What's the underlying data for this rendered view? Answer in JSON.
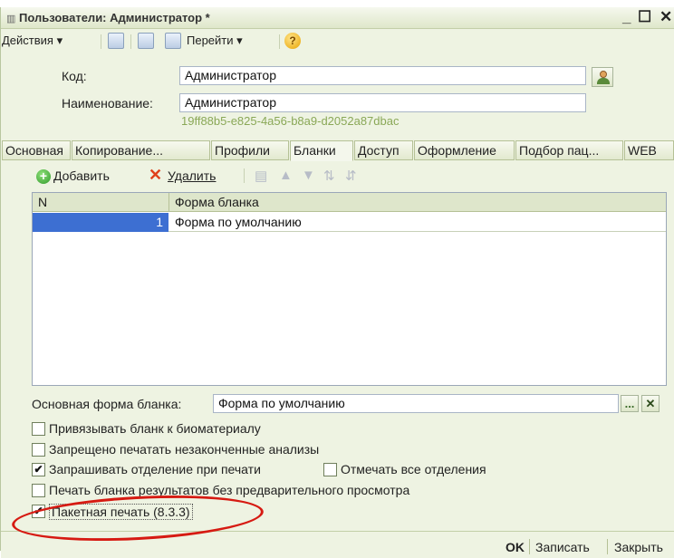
{
  "window": {
    "title": "Пользователи: Администратор *",
    "controls": [
      "_",
      "☐",
      "✕"
    ]
  },
  "toolbar": {
    "actions_label": "Действия ▾",
    "goto_label": "Перейти ▾",
    "help_glyph": "?"
  },
  "form": {
    "code_label": "Код:",
    "code_value": "Администратор",
    "name_label": "Наименование:",
    "name_value": "Администратор",
    "guid": "19ff88b5-e825-4a56-b8a9-d2052a87dbac"
  },
  "tabs": [
    {
      "label": "Основная"
    },
    {
      "label": "Копирование..."
    },
    {
      "label": "Профили"
    },
    {
      "label": "Бланки"
    },
    {
      "label": "Доступ"
    },
    {
      "label": "Оформление"
    },
    {
      "label": "Подбор пац..."
    },
    {
      "label": "WEB"
    }
  ],
  "active_tab": "Бланки",
  "blanks_toolbar": {
    "add_label": "Добавить",
    "delete_label": "Удалить"
  },
  "grid": {
    "columns": [
      "N",
      "Форма бланка"
    ],
    "rows": [
      {
        "n": "1",
        "form": "Форма по умолчанию"
      }
    ]
  },
  "main_form": {
    "label": "Основная форма бланка:",
    "value": "Форма по умолчанию",
    "select_glyph": "...",
    "clear_glyph": "✕"
  },
  "checkboxes": [
    {
      "label": "Привязывать бланк к биоматериалу",
      "checked": false
    },
    {
      "label": "Запрещено печатать незаконченные анализы",
      "checked": false
    },
    {
      "label": "Запрашивать отделение при печати",
      "checked": true
    },
    {
      "label": "Отмечать все отделения",
      "checked": false
    },
    {
      "label": "Печать бланка результатов без предварительного просмотра",
      "checked": false
    },
    {
      "label": "Пакетная печать (8.3.3)",
      "checked": true
    }
  ],
  "footer": {
    "ok_label": "OK",
    "save_label": "Записать",
    "close_label": "Закрыть"
  },
  "colors": {
    "window_bg": "#eef3e2",
    "selection": "#3d6fd2",
    "guid_text": "#8aa857",
    "highlight_oval": "#d61a12"
  }
}
